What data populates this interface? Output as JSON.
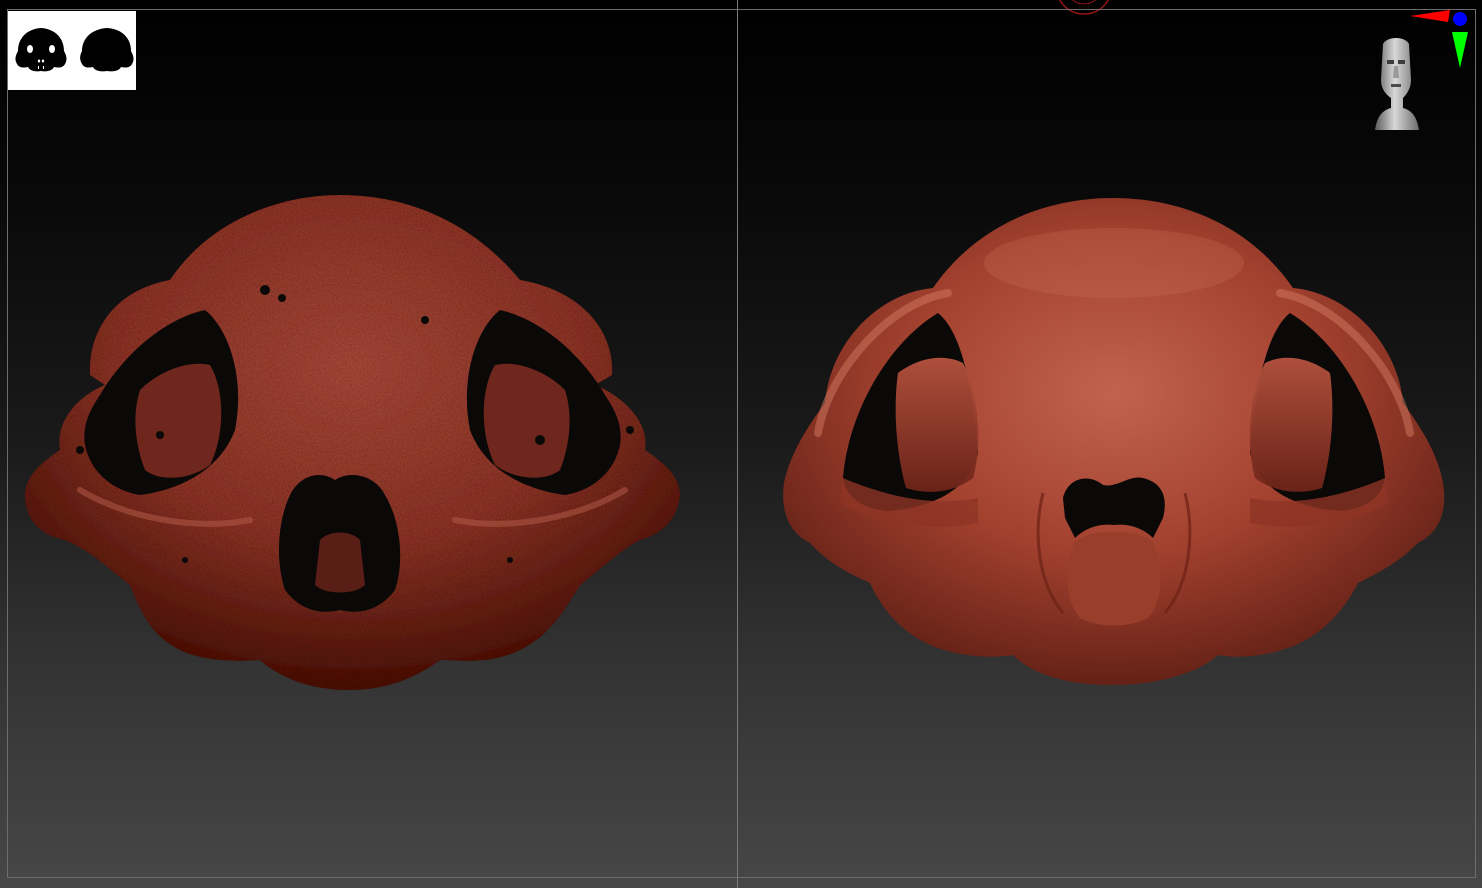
{
  "viewport": {
    "background_top": "#000000",
    "background_bottom": "#474747",
    "frame_color": "#6d6d6d",
    "layout": "split-screen"
  },
  "thumbnail": {
    "icon": "skull-silhouette-icon",
    "count": 2
  },
  "models": [
    {
      "name": "scanned-skull",
      "surface": "noisy",
      "color": "#8a2f22"
    },
    {
      "name": "sculpted-skull",
      "surface": "smooth",
      "color": "#a8412f"
    }
  ],
  "gizmos": {
    "navigation_head": "head-gizmo-icon",
    "axis": {
      "x_color": "#ff0000",
      "y_color": "#00ff00",
      "z_color": "#0000ff"
    },
    "floor_marker_color": "#b01818"
  }
}
